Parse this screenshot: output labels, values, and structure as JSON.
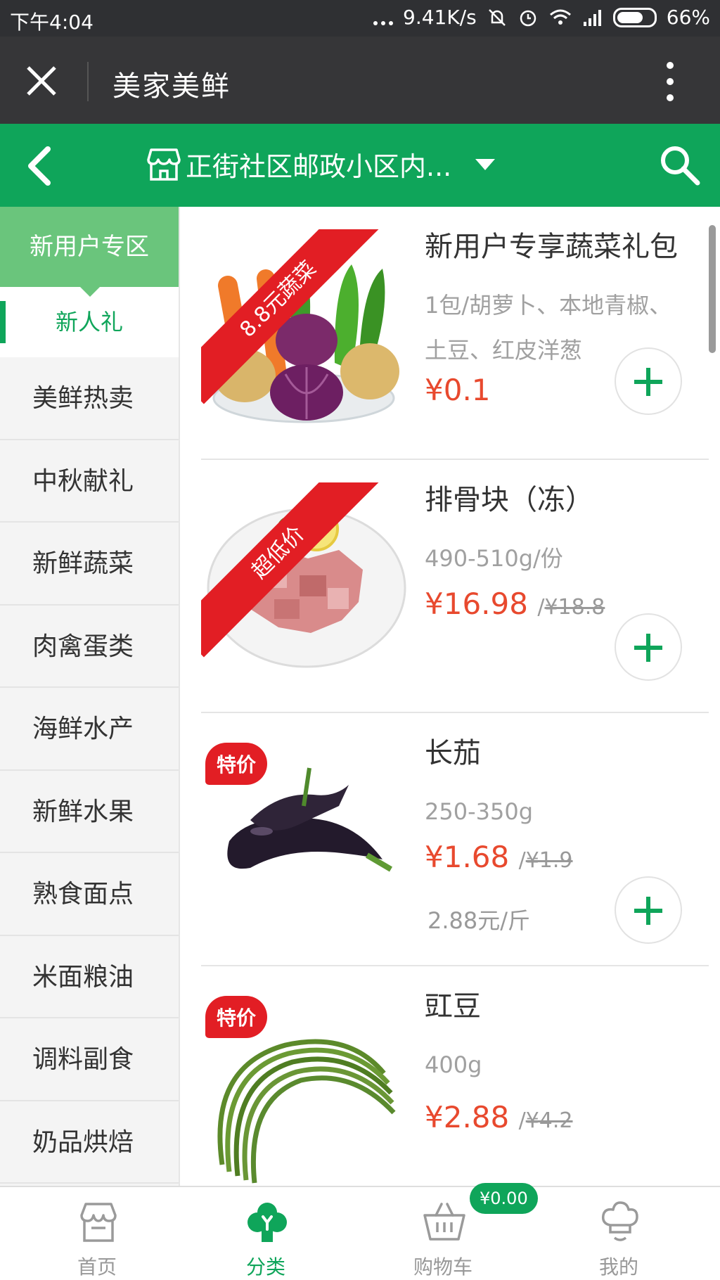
{
  "status_bar": {
    "time": "下午4:04",
    "speed": "9.41K/s",
    "battery": "66%"
  },
  "app_bar": {
    "title": "美家美鲜",
    "icons": [
      "close-icon",
      "more-vertical-icon"
    ]
  },
  "header": {
    "location": "正街社区邮政小区内...",
    "icons": [
      "back-arrow-icon",
      "store-icon",
      "dropdown-caret-icon",
      "search-icon"
    ],
    "color": "#0fa55a"
  },
  "sidebar": {
    "section_title": "新用户专区",
    "active_item": "新人礼",
    "items": [
      "美鲜热卖",
      "中秋献礼",
      "新鲜蔬菜",
      "肉禽蛋类",
      "海鲜水产",
      "新鲜水果",
      "熟食面点",
      "米面粮油",
      "调料副食",
      "奶品烘焙"
    ]
  },
  "products": [
    {
      "name": "新用户专享蔬菜礼包",
      "spec_line1": "1包/胡萝卜、本地青椒、",
      "spec_line2": "土豆、红皮洋葱",
      "price": "¥0.1",
      "ribbon": "8.8元蔬菜"
    },
    {
      "name": "排骨块（冻）",
      "spec": "490-510g/份",
      "price": "¥16.98",
      "old_price": "¥18.8",
      "ribbon": "超低价"
    },
    {
      "name": "长茄",
      "spec": "250-350g",
      "price": "¥1.68",
      "old_price": "¥1.9",
      "unit_price": "2.88元/斤",
      "badge": "特价"
    },
    {
      "name": "豇豆",
      "spec": "400g",
      "price": "¥2.88",
      "old_price": "¥4.2",
      "badge": "特价"
    }
  ],
  "bottom_nav": {
    "items": [
      {
        "label": "首页",
        "icon": "home-store-icon"
      },
      {
        "label": "分类",
        "icon": "category-icon",
        "active": true
      },
      {
        "label": "购物车",
        "icon": "cart-basket-icon"
      },
      {
        "label": "我的",
        "icon": "chef-hat-icon"
      }
    ],
    "cart_badge": "¥0.00"
  },
  "colors": {
    "accent": "#0fa55a",
    "price": "#e8492e",
    "badge_red": "#e21e24"
  }
}
